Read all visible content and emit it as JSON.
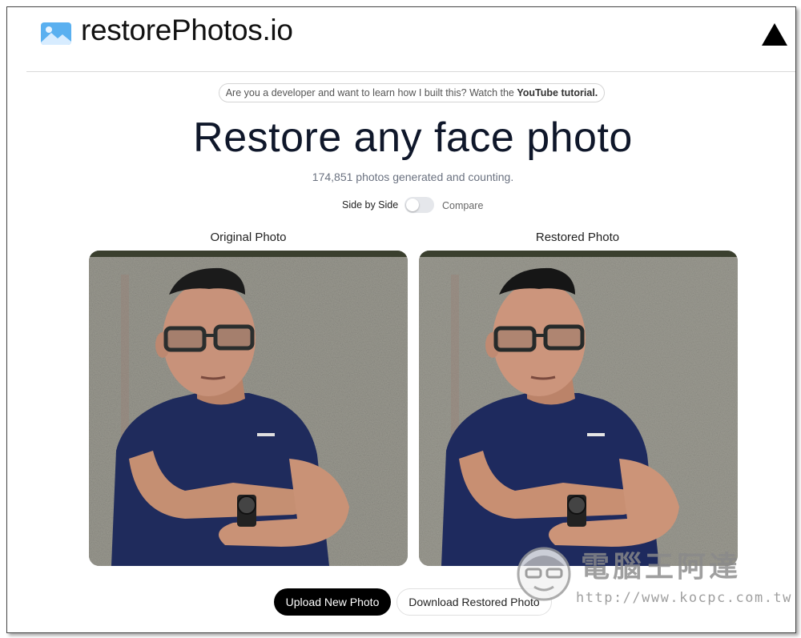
{
  "header": {
    "brand": "restorePhotos.io",
    "logo_icon": "image-landscape-icon",
    "github_icon": "triangle-icon"
  },
  "banner": {
    "text": "Are you a developer and want to learn how I built this? Watch the ",
    "link_text": "YouTube tutorial."
  },
  "hero": {
    "title": "Restore any face photo",
    "counter": "174,851 photos generated and counting."
  },
  "view_toggle": {
    "left_label": "Side by Side",
    "right_label": "Compare",
    "state": "side-by-side"
  },
  "photos": {
    "original_label": "Original Photo",
    "restored_label": "Restored Photo"
  },
  "actions": {
    "upload_label": "Upload New Photo",
    "download_label": "Download Restored Photo"
  },
  "watermark": {
    "text": "電腦王阿達",
    "url": "http://www.kocpc.com.tw"
  },
  "colors": {
    "title": "#0f172a",
    "primary_button": "#000000",
    "shirt": "#1e2a5e",
    "wall": "#8b8b84"
  }
}
